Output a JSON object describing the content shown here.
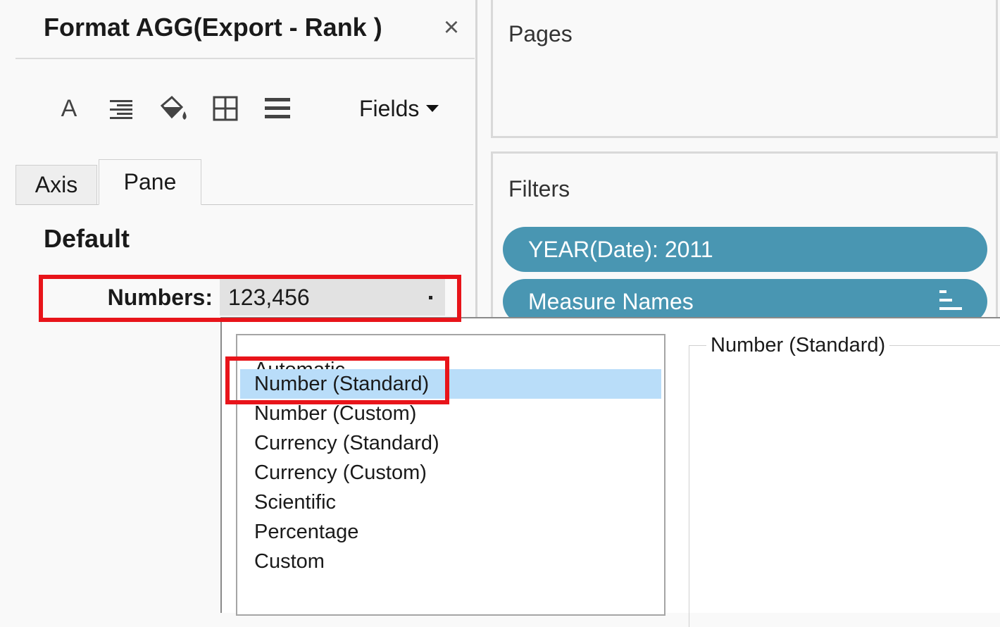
{
  "format_pane": {
    "title": "Format AGG(Export - Rank )",
    "close_glyph": "×",
    "toolbar": {
      "icons": [
        "font-icon",
        "alignment-icon",
        "shading-icon",
        "borders-icon",
        "lines-icon"
      ],
      "font_glyph": "A",
      "fields_label": "Fields"
    },
    "tabs": [
      {
        "label": "Axis",
        "active": false
      },
      {
        "label": "Pane",
        "active": true
      }
    ],
    "section_title": "Default",
    "numbers": {
      "label": "Numbers:",
      "value": "123,456"
    }
  },
  "shelves": {
    "pages": {
      "title": "Pages"
    },
    "filters": {
      "title": "Filters",
      "pills": [
        {
          "label": "YEAR(Date): 2011"
        },
        {
          "label": "Measure Names"
        }
      ]
    },
    "pill_color": "#4996b2"
  },
  "format_dropdown": {
    "options": [
      {
        "label": "Automatic",
        "selected": false
      },
      {
        "label": "Number (Standard)",
        "selected": true
      },
      {
        "label": "Number (Custom)",
        "selected": false
      },
      {
        "label": "Currency (Standard)",
        "selected": false
      },
      {
        "label": "Currency (Custom)",
        "selected": false
      },
      {
        "label": "Scientific",
        "selected": false
      },
      {
        "label": "Percentage",
        "selected": false
      },
      {
        "label": "Custom",
        "selected": false
      }
    ],
    "preview_title": "Number (Standard)",
    "selection_color": "#b9ddf9"
  },
  "annotation_color": "#e8141a"
}
